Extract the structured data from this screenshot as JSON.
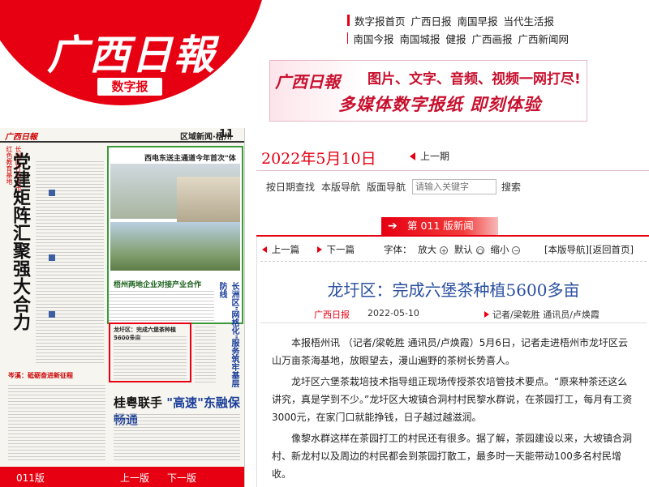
{
  "brand": {
    "logo": "广西日報",
    "sub": "数字报"
  },
  "top_nav": {
    "row1": [
      "数字报首页",
      "广西日报",
      "南国早报",
      "当代生活报"
    ],
    "row2": [
      "南国今报",
      "南国城报",
      "健报",
      "广西画报",
      "广西新闻网"
    ]
  },
  "banner": {
    "logo": "广西日報",
    "line1": "图片、文字、音频、视频一网打尽!",
    "line2": "多媒体数字报纸  即刻体验"
  },
  "paper": {
    "name": "广西日報",
    "section": "区域新闻",
    "section_city": "梧州",
    "page_no": "11",
    "left_red": "长洲区打造全市红色教育基地",
    "headline": "党建矩阵汇聚强大合力",
    "green_title": "西电东送主通道今年首次\"体检\"",
    "section_mid": "梧州两地企业对接产业合作",
    "red_box_title": "龙圩区：完成六堡茶种植5600多亩",
    "strip": "岑溪：砥砺奋进新征程",
    "big_head_a": "桂粤联手",
    "big_head_b": "\"高速\"东融保畅通",
    "vert_right": "长洲区\"网格化\"服务筑牢基层防线",
    "foot_page": "011版",
    "foot_prev": "上一版",
    "foot_next": "下一版"
  },
  "date_bar": {
    "date": "2022年5月10日",
    "prev": "上一期"
  },
  "tools": {
    "by_date": "按日期查找",
    "layout_nav": "本版导航",
    "page_nav": "版面导航",
    "search_placeholder": "请输入关键字",
    "search_btn": "搜索"
  },
  "section_tab": {
    "arrow": "➔",
    "label": "第 011 版新闻"
  },
  "article_nav": {
    "prev": "上一篇",
    "next": "下一篇",
    "font_label": "字体：",
    "enlarge": "放大",
    "enlarge_icon": "+",
    "default": "默认",
    "default_icon": "○",
    "shrink": "缩小",
    "shrink_icon": "−",
    "layout_nav": "[本版导航]",
    "home": "[返回首页]"
  },
  "article": {
    "title": "龙圩区：完成六堡茶种植5600多亩",
    "source": "广西日报",
    "date": "2022-05-10",
    "author": "记者/梁乾胜 通讯员/卢焕霞",
    "paragraphs": [
      "本报梧州讯  （记者/梁乾胜 通讯员/卢焕霞）5月6日，记者走进梧州市龙圩区云山万亩茶海基地，放眼望去，漫山遍野的茶树长势喜人。",
      "龙圩区六堡茶栽培技术指导组正现场传授茶农培管技术要点。“原来种茶还这么讲究，真是学到不少。”龙圩区大坡镇合洞村村民黎水群说，在茶园打工，每月有工资3000元，在家门口就能挣钱，日子越过越滋润。",
      "像黎水群这样在茶园打工的村民还有很多。据了解，茶园建设以来，大坡镇合洞村、新龙村以及周边的村民都会到茶园打散工，最多时一天能带动100多名村民增收。"
    ]
  },
  "colors": {
    "brand_red": "#e60012",
    "title_blue": "#2a4fa0"
  }
}
